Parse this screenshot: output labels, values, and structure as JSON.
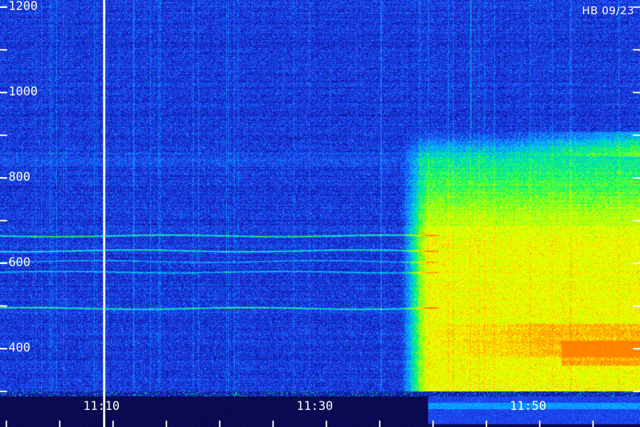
{
  "chart_data": {
    "type": "heatmap",
    "title": "",
    "watermark": "HB 09/23",
    "xlabel": "",
    "ylabel": "",
    "x_ticks": [
      {
        "label": "11:10",
        "minutes": 70
      },
      {
        "label": "11:30",
        "minutes": 90
      },
      {
        "label": "11:50",
        "minutes": 110
      }
    ],
    "x_range_minutes": [
      60.2,
      118.2
    ],
    "y_ticks": [
      400,
      600,
      800,
      1000,
      1200
    ],
    "y_range": [
      300,
      1200
    ],
    "marker_time_minutes": 70,
    "narrowband_lines_y": [
      665,
      630,
      605,
      580,
      495
    ],
    "event": {
      "onset_minutes": 99.5,
      "low_y": 300,
      "high_y": 850,
      "peak_y": [
        380,
        460
      ]
    },
    "colormap": [
      "#08082e",
      "#1010a0",
      "#2050ff",
      "#00c0ff",
      "#00ff60",
      "#c0ff00",
      "#ffff00",
      "#ff8000"
    ],
    "grid": false,
    "legend": "none"
  }
}
